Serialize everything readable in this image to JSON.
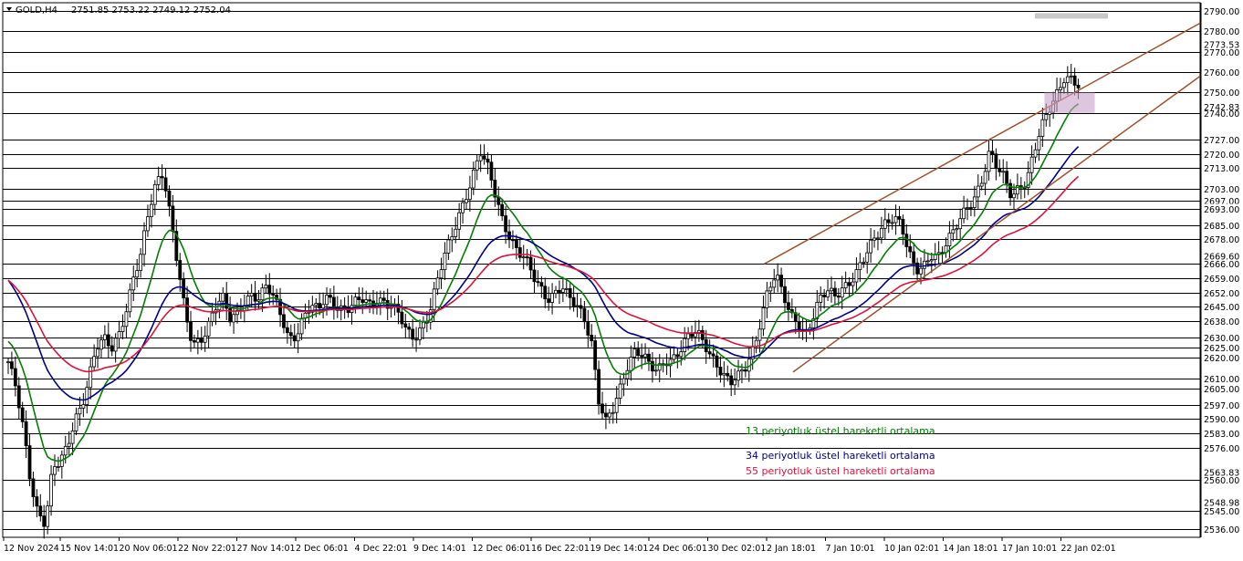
{
  "header": {
    "symbol": "GOLD,H4",
    "ohlc": "2751.85 2753.22 2749.12 2752.04"
  },
  "colors": {
    "background": "#ffffff",
    "candles": "#000000",
    "ema13": "#008000",
    "ema34": "#00008b",
    "ema55": "#dc143c",
    "channel": "#a0522d",
    "zone": "#c8a2c8",
    "levels": "#000000"
  },
  "chart_data": {
    "type": "candlestick",
    "symbol": "GOLD",
    "timeframe": "H4",
    "ylim": [
      2532,
      2794
    ],
    "price_levels": [
      2790.0,
      2780.0,
      2770.0,
      2760.0,
      2750.0,
      2740.0,
      2727.0,
      2720.0,
      2713.0,
      2703.0,
      2697.0,
      2693.0,
      2685.0,
      2678.0,
      2666.0,
      2659.0,
      2652.0,
      2645.0,
      2638.0,
      2630.0,
      2625.0,
      2620.0,
      2610.0,
      2605.0,
      2597.0,
      2590.0,
      2583.0,
      2576.0,
      2560.0,
      2545.0,
      2536.0
    ],
    "faint_axis_labels": [
      "2773.53",
      "2742.83",
      "2669.60",
      "2563.83",
      "2548.98"
    ],
    "x_labels": [
      "12 Nov 2024",
      "15 Nov 14:01",
      "20 Nov 06:01",
      "22 Nov 22:01",
      "27 Nov 14:01",
      "2 Dec 06:01",
      "4 Dec 22:01",
      "9 Dec 14:01",
      "12 Dec 06:01",
      "16 Dec 22:01",
      "19 Dec 14:01",
      "24 Dec 06:01",
      "30 Dec 02:01",
      "2 Jan 18:01",
      "7 Jan 10:01",
      "10 Jan 02:01",
      "14 Jan 18:01",
      "17 Jan 10:01",
      "22 Jan 02:01"
    ],
    "close_path": [
      2618,
      2605,
      2585,
      2560,
      2545,
      2540,
      2565,
      2568,
      2575,
      2590,
      2598,
      2612,
      2625,
      2628,
      2624,
      2632,
      2645,
      2660,
      2670,
      2690,
      2705,
      2712,
      2690,
      2665,
      2640,
      2625,
      2628,
      2636,
      2646,
      2650,
      2638,
      2640,
      2648,
      2652,
      2650,
      2655,
      2648,
      2640,
      2630,
      2632,
      2640,
      2645,
      2642,
      2650,
      2648,
      2645,
      2644,
      2646,
      2648,
      2646,
      2650,
      2648,
      2645,
      2640,
      2632,
      2630,
      2636,
      2642,
      2655,
      2668,
      2678,
      2690,
      2700,
      2710,
      2720,
      2712,
      2700,
      2688,
      2680,
      2672,
      2668,
      2660,
      2655,
      2650,
      2652,
      2655,
      2648,
      2645,
      2640,
      2630,
      2600,
      2588,
      2594,
      2605,
      2618,
      2625,
      2622,
      2615,
      2612,
      2618,
      2620,
      2625,
      2630,
      2632,
      2628,
      2622,
      2618,
      2612,
      2608,
      2610,
      2615,
      2625,
      2640,
      2655,
      2660,
      2650,
      2640,
      2638,
      2632,
      2640,
      2648,
      2652,
      2650,
      2655,
      2658,
      2662,
      2668,
      2675,
      2682,
      2688,
      2690,
      2685,
      2670,
      2662,
      2665,
      2672,
      2670,
      2675,
      2680,
      2688,
      2695,
      2700,
      2708,
      2720,
      2712,
      2708,
      2700,
      2705,
      2706,
      2720,
      2732,
      2742,
      2750,
      2758,
      2756,
      2752
    ],
    "ema13_label": "13 periyotluk üstel hareketli ortalama",
    "ema34_label": "34 periyotluk üstel hareketli ortalama",
    "ema55_label": "55 periyotluk üstel hareketli ortalama",
    "channel": {
      "upper": [
        {
          "t": 0.636,
          "p": 2666
        },
        {
          "t": 1.0,
          "p": 2784
        }
      ],
      "lower": [
        {
          "t": 0.66,
          "p": 2613
        },
        {
          "t": 1.0,
          "p": 2758
        }
      ]
    },
    "zone": {
      "t0": 0.87,
      "t1": 0.912,
      "p_low": 2740,
      "p_high": 2750
    },
    "top_band": {
      "t0": 0.862,
      "t1": 0.923,
      "p": 2788
    }
  }
}
